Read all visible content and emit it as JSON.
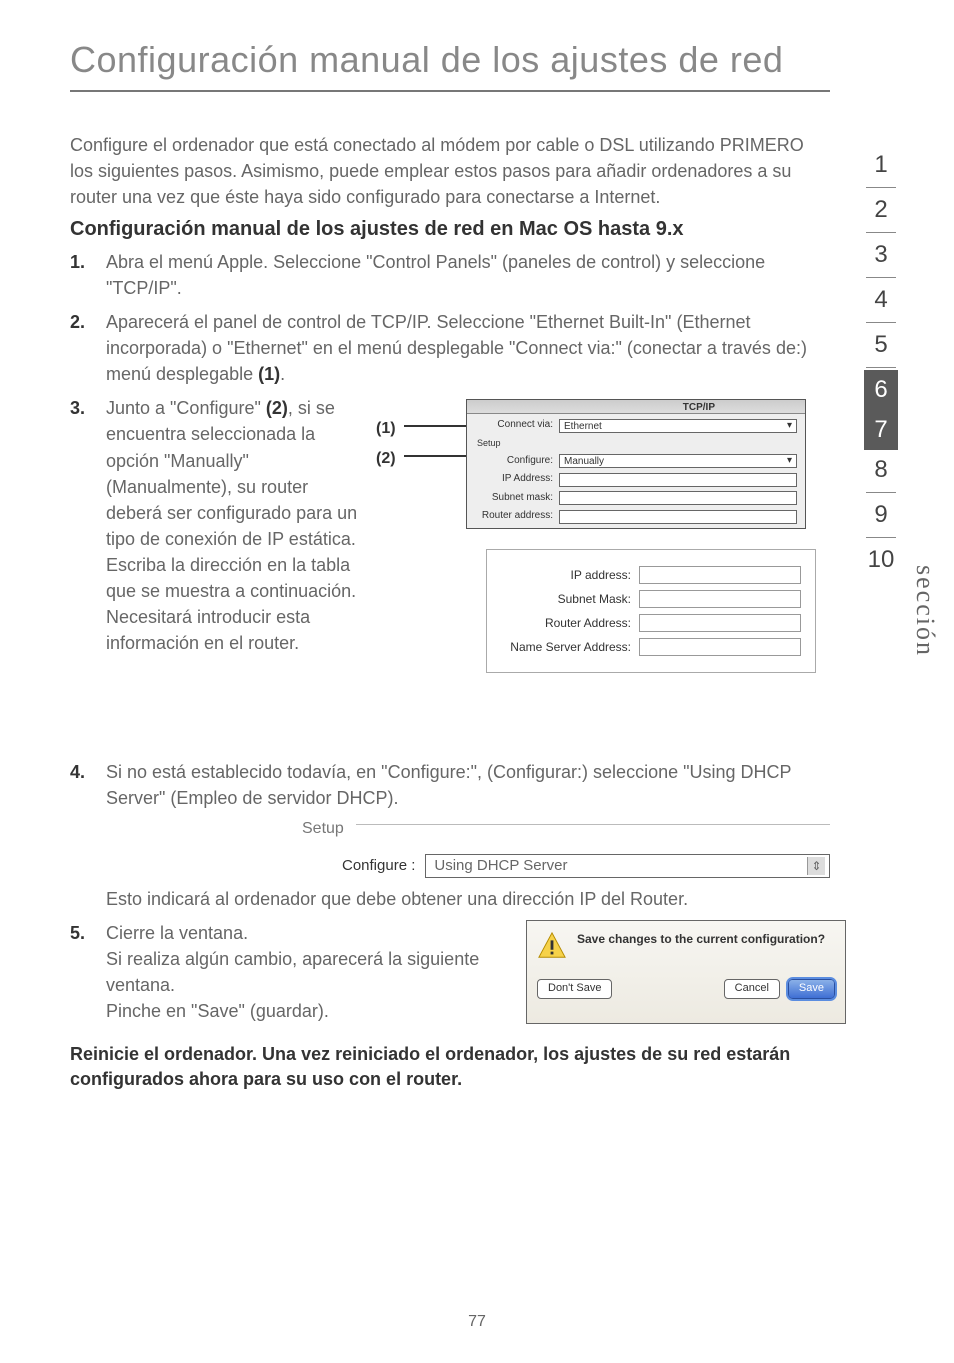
{
  "title": "Configuración manual de los ajustes de red",
  "intro": "Configure el ordenador que está conectado al módem por cable o DSL utilizando PRIMERO los siguientes pasos. Asimismo, puede emplear estos pasos para añadir ordenadores a su router una vez que éste haya sido configurado para conectarse a Internet.",
  "subhead": "Configuración manual de los ajustes de red en Mac OS hasta 9.x",
  "steps": {
    "s1": {
      "n": "1.",
      "t": "Abra el menú Apple. Seleccione \"Control Panels\" (paneles de control) y seleccione \"TCP/IP\"."
    },
    "s2": {
      "n": "2.",
      "t_pre": "Aparecerá el panel de control de TCP/IP. Seleccione \"Ethernet Built-In\" (Ethernet incorporada) o \"Ethernet\" en el menú desplegable \"Connect via:\" (conectar a través de:) menú desplegable ",
      "ref": "(1)",
      "t_post": "."
    },
    "s3": {
      "n": "3.",
      "t_pre": "Junto a \"Configure\" ",
      "ref": "(2)",
      "t_post": ", si se encuentra seleccionada la opción \"Manually\" (Manualmente), su router deberá ser configurado para un tipo de conexión de IP estática. Escriba la dirección en la tabla que se muestra a continuación. Necesitará introducir esta información en el router."
    },
    "s4": {
      "n": "4.",
      "t_pre": "Si no está establecido todavía, en \"Configure:\", (Configurar:) seleccione \"Using DHCP Server\" (Empleo de servidor DHCP).",
      "t_post": "Esto indicará al ordenador que debe obtener una dirección IP del Router."
    },
    "s5": {
      "n": "5.",
      "lines": [
        "Cierre la ventana.",
        "Si realiza algún cambio, aparecerá la siguiente ventana.",
        "Pinche en \"Save\" (guardar)."
      ]
    }
  },
  "pointers": {
    "p1": "(1)",
    "p2": "(2)"
  },
  "tcpip_dlg": {
    "title": "TCP/IP",
    "connect_label": "Connect via:",
    "connect_value": "Ethernet",
    "setup_label": "Setup",
    "configure_label": "Configure:",
    "configure_value": "Manually",
    "ip_label": "IP Address:",
    "subnet_label": "Subnet mask:",
    "router_label": "Router address:"
  },
  "ip_panel": {
    "ip": "IP address:",
    "subnet": "Subnet Mask:",
    "router": "Router Address:",
    "nameserver": "Name Server Address:"
  },
  "setup_frag": {
    "title": "Setup",
    "configure_label": "Configure :",
    "configure_value": "Using DHCP Server"
  },
  "save_dlg": {
    "text": "Save changes to the current configuration?",
    "dont_save": "Don't Save",
    "cancel": "Cancel",
    "save": "Save"
  },
  "closing": "Reinicie el ordenador. Una vez reiniciado el ordenador, los ajustes de su red estarán configurados ahora para su uso con el router.",
  "sidenav": [
    "1",
    "2",
    "3",
    "4",
    "5",
    "6",
    "7",
    "8",
    "9",
    "10"
  ],
  "active_indices": [
    5,
    6
  ],
  "section_label": "sección",
  "page_number": "77"
}
